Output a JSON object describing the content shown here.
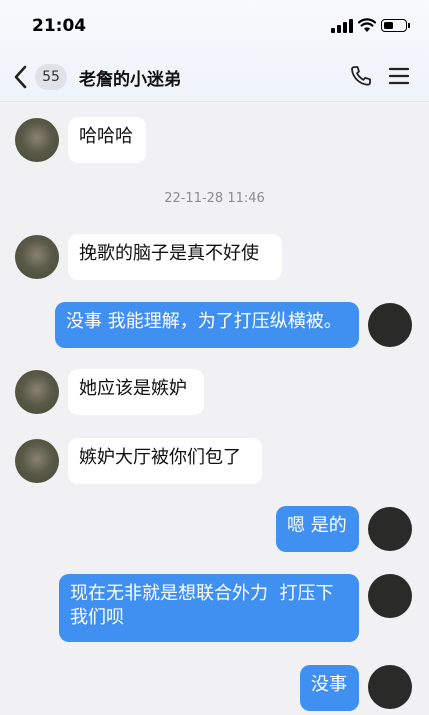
{
  "status_bar": {
    "time": "21:04"
  },
  "header": {
    "unread_count": "55",
    "title": "老詹的小迷弟"
  },
  "colors": {
    "outgoing_bubble": "#3f90f1",
    "incoming_bubble": "#ffffff",
    "background": "#f1f1f3"
  },
  "messages": [
    {
      "sender": "other",
      "text": "哈哈哈"
    },
    {
      "timestamp": "22-11-28 11:46"
    },
    {
      "sender": "other",
      "text": "挽歌的脑子是真不好使"
    },
    {
      "sender": "self",
      "text": "没事 我能理解，为了打压纵横被。"
    },
    {
      "sender": "other",
      "text": "她应该是嫉妒"
    },
    {
      "sender": "other",
      "text": "嫉妒大厅被你们包了"
    },
    {
      "sender": "self",
      "text": "嗯 是的"
    },
    {
      "sender": "self",
      "text": "现在无非就是想联合外力  打压下\n我们呗"
    },
    {
      "sender": "self",
      "text": "没事"
    }
  ]
}
